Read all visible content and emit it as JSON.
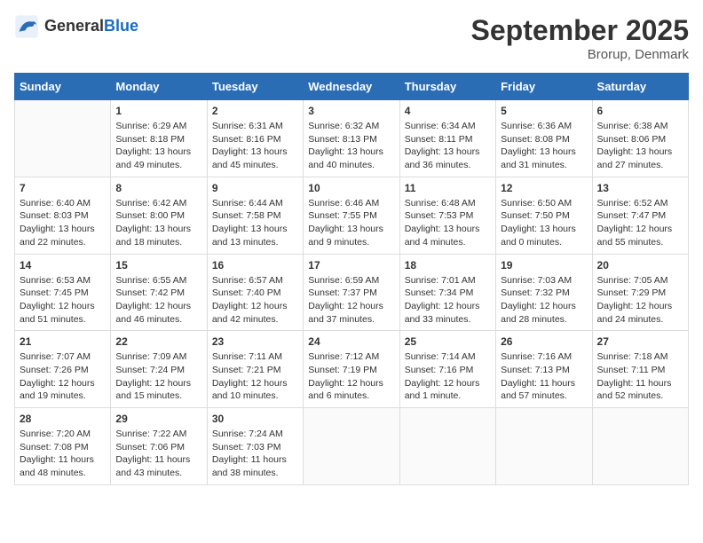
{
  "header": {
    "logo_general": "General",
    "logo_blue": "Blue",
    "month_title": "September 2025",
    "location": "Brorup, Denmark"
  },
  "days_of_week": [
    "Sunday",
    "Monday",
    "Tuesday",
    "Wednesday",
    "Thursday",
    "Friday",
    "Saturday"
  ],
  "weeks": [
    [
      {
        "day": "",
        "info": ""
      },
      {
        "day": "1",
        "info": "Sunrise: 6:29 AM\nSunset: 8:18 PM\nDaylight: 13 hours\nand 49 minutes."
      },
      {
        "day": "2",
        "info": "Sunrise: 6:31 AM\nSunset: 8:16 PM\nDaylight: 13 hours\nand 45 minutes."
      },
      {
        "day": "3",
        "info": "Sunrise: 6:32 AM\nSunset: 8:13 PM\nDaylight: 13 hours\nand 40 minutes."
      },
      {
        "day": "4",
        "info": "Sunrise: 6:34 AM\nSunset: 8:11 PM\nDaylight: 13 hours\nand 36 minutes."
      },
      {
        "day": "5",
        "info": "Sunrise: 6:36 AM\nSunset: 8:08 PM\nDaylight: 13 hours\nand 31 minutes."
      },
      {
        "day": "6",
        "info": "Sunrise: 6:38 AM\nSunset: 8:06 PM\nDaylight: 13 hours\nand 27 minutes."
      }
    ],
    [
      {
        "day": "7",
        "info": "Sunrise: 6:40 AM\nSunset: 8:03 PM\nDaylight: 13 hours\nand 22 minutes."
      },
      {
        "day": "8",
        "info": "Sunrise: 6:42 AM\nSunset: 8:00 PM\nDaylight: 13 hours\nand 18 minutes."
      },
      {
        "day": "9",
        "info": "Sunrise: 6:44 AM\nSunset: 7:58 PM\nDaylight: 13 hours\nand 13 minutes."
      },
      {
        "day": "10",
        "info": "Sunrise: 6:46 AM\nSunset: 7:55 PM\nDaylight: 13 hours\nand 9 minutes."
      },
      {
        "day": "11",
        "info": "Sunrise: 6:48 AM\nSunset: 7:53 PM\nDaylight: 13 hours\nand 4 minutes."
      },
      {
        "day": "12",
        "info": "Sunrise: 6:50 AM\nSunset: 7:50 PM\nDaylight: 13 hours\nand 0 minutes."
      },
      {
        "day": "13",
        "info": "Sunrise: 6:52 AM\nSunset: 7:47 PM\nDaylight: 12 hours\nand 55 minutes."
      }
    ],
    [
      {
        "day": "14",
        "info": "Sunrise: 6:53 AM\nSunset: 7:45 PM\nDaylight: 12 hours\nand 51 minutes."
      },
      {
        "day": "15",
        "info": "Sunrise: 6:55 AM\nSunset: 7:42 PM\nDaylight: 12 hours\nand 46 minutes."
      },
      {
        "day": "16",
        "info": "Sunrise: 6:57 AM\nSunset: 7:40 PM\nDaylight: 12 hours\nand 42 minutes."
      },
      {
        "day": "17",
        "info": "Sunrise: 6:59 AM\nSunset: 7:37 PM\nDaylight: 12 hours\nand 37 minutes."
      },
      {
        "day": "18",
        "info": "Sunrise: 7:01 AM\nSunset: 7:34 PM\nDaylight: 12 hours\nand 33 minutes."
      },
      {
        "day": "19",
        "info": "Sunrise: 7:03 AM\nSunset: 7:32 PM\nDaylight: 12 hours\nand 28 minutes."
      },
      {
        "day": "20",
        "info": "Sunrise: 7:05 AM\nSunset: 7:29 PM\nDaylight: 12 hours\nand 24 minutes."
      }
    ],
    [
      {
        "day": "21",
        "info": "Sunrise: 7:07 AM\nSunset: 7:26 PM\nDaylight: 12 hours\nand 19 minutes."
      },
      {
        "day": "22",
        "info": "Sunrise: 7:09 AM\nSunset: 7:24 PM\nDaylight: 12 hours\nand 15 minutes."
      },
      {
        "day": "23",
        "info": "Sunrise: 7:11 AM\nSunset: 7:21 PM\nDaylight: 12 hours\nand 10 minutes."
      },
      {
        "day": "24",
        "info": "Sunrise: 7:12 AM\nSunset: 7:19 PM\nDaylight: 12 hours\nand 6 minutes."
      },
      {
        "day": "25",
        "info": "Sunrise: 7:14 AM\nSunset: 7:16 PM\nDaylight: 12 hours\nand 1 minute."
      },
      {
        "day": "26",
        "info": "Sunrise: 7:16 AM\nSunset: 7:13 PM\nDaylight: 11 hours\nand 57 minutes."
      },
      {
        "day": "27",
        "info": "Sunrise: 7:18 AM\nSunset: 7:11 PM\nDaylight: 11 hours\nand 52 minutes."
      }
    ],
    [
      {
        "day": "28",
        "info": "Sunrise: 7:20 AM\nSunset: 7:08 PM\nDaylight: 11 hours\nand 48 minutes."
      },
      {
        "day": "29",
        "info": "Sunrise: 7:22 AM\nSunset: 7:06 PM\nDaylight: 11 hours\nand 43 minutes."
      },
      {
        "day": "30",
        "info": "Sunrise: 7:24 AM\nSunset: 7:03 PM\nDaylight: 11 hours\nand 38 minutes."
      },
      {
        "day": "",
        "info": ""
      },
      {
        "day": "",
        "info": ""
      },
      {
        "day": "",
        "info": ""
      },
      {
        "day": "",
        "info": ""
      }
    ]
  ]
}
